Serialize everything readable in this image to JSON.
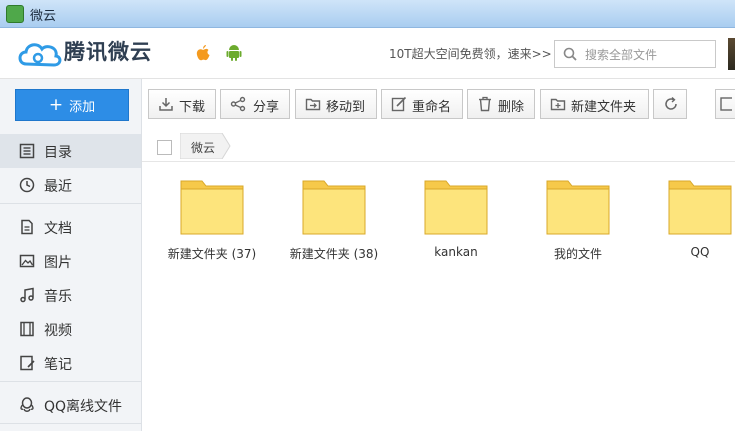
{
  "window": {
    "title": "微云"
  },
  "header": {
    "brand": "腾讯微云",
    "promo": "10T超大空间免费领，速来>>",
    "search_placeholder": "搜索全部文件"
  },
  "sidebar": {
    "add_label": "添加",
    "items": [
      {
        "label": "目录",
        "icon": "list-icon",
        "active": true
      },
      {
        "label": "最近",
        "icon": "clock-icon"
      },
      {
        "label": "文档",
        "icon": "document-icon"
      },
      {
        "label": "图片",
        "icon": "image-icon"
      },
      {
        "label": "音乐",
        "icon": "music-icon"
      },
      {
        "label": "视频",
        "icon": "video-icon"
      },
      {
        "label": "笔记",
        "icon": "note-icon"
      },
      {
        "label": "QQ离线文件",
        "icon": "qq-icon"
      }
    ]
  },
  "toolbar": {
    "download": "下载",
    "share": "分享",
    "move": "移动到",
    "rename": "重命名",
    "delete": "删除",
    "new_folder": "新建文件夹"
  },
  "breadcrumb": {
    "current": "微云"
  },
  "files": [
    {
      "name": "新建文件夹 (37)"
    },
    {
      "name": "新建文件夹 (38)"
    },
    {
      "name": "kankan"
    },
    {
      "name": "我的文件"
    },
    {
      "name": "QQ"
    }
  ],
  "colors": {
    "accent": "#2d8de6",
    "folder": "#fde47c",
    "folder_tab": "#f6c94a"
  }
}
